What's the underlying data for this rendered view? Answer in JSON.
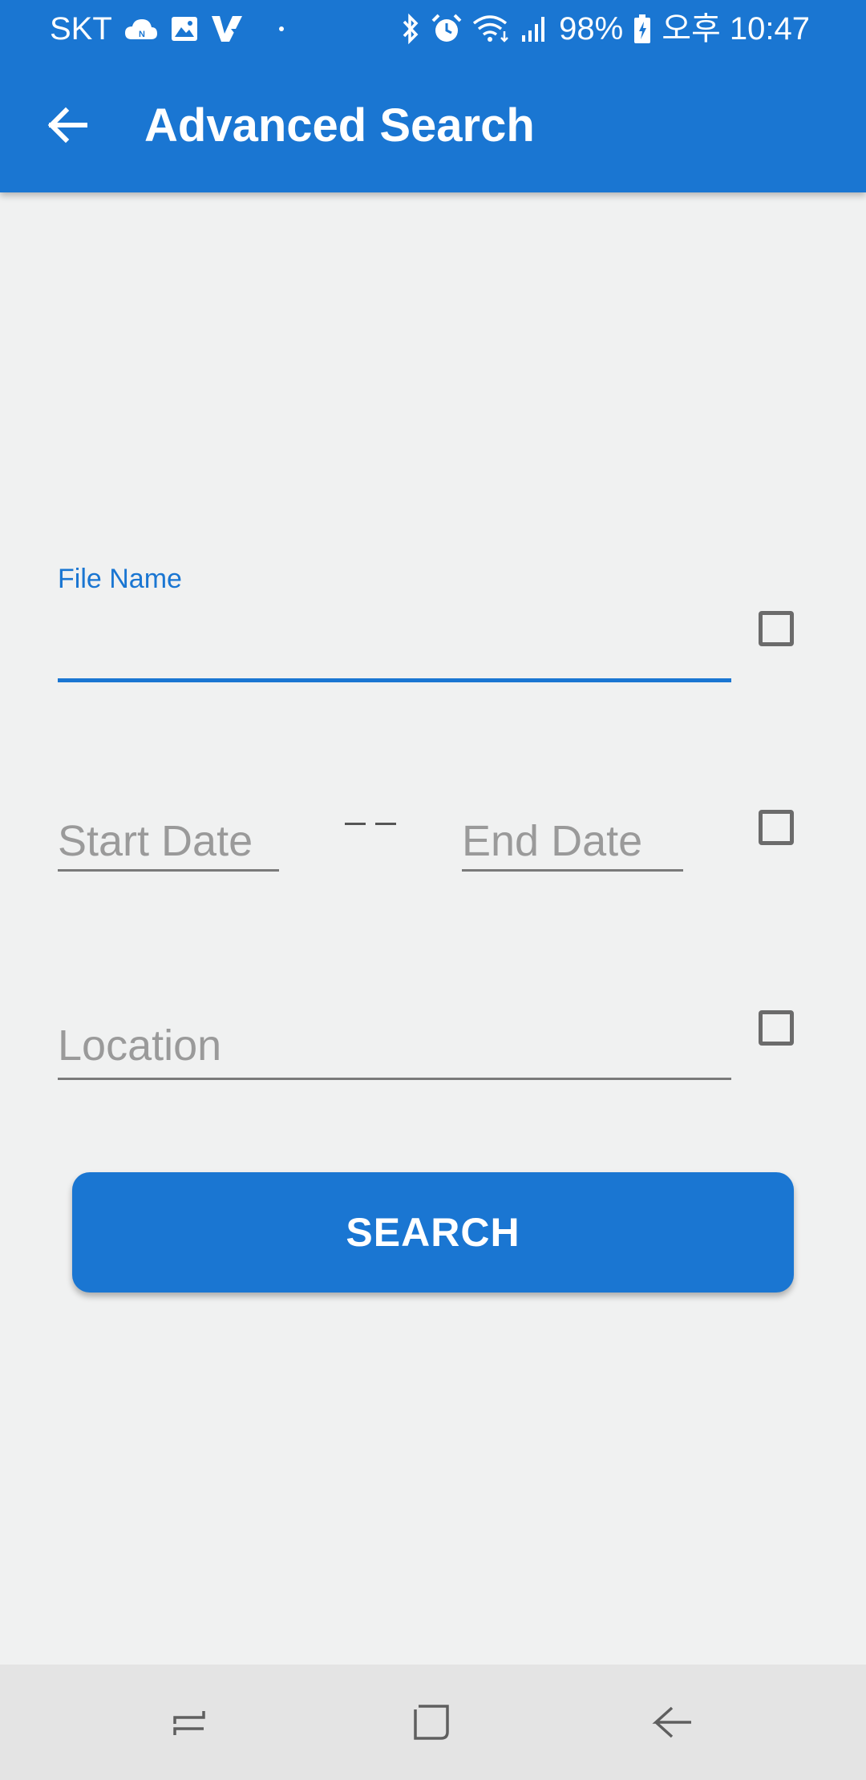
{
  "status_bar": {
    "carrier": "SKT",
    "battery": "98%",
    "time": "오후 10:47",
    "left_icons": [
      "cloud-icon",
      "image-icon",
      "v-app-icon"
    ],
    "right_icons": [
      "bluetooth-icon",
      "alarm-icon",
      "wifi-icon",
      "signal-icon",
      "battery-icon"
    ]
  },
  "toolbar": {
    "title": "Advanced Search",
    "back_icon": "back-arrow-icon"
  },
  "form": {
    "file_name": {
      "label": "File Name",
      "value": "",
      "checked": false
    },
    "date_range": {
      "start_placeholder": "Start Date",
      "end_placeholder": "End Date",
      "checked": false
    },
    "location": {
      "placeholder": "Location",
      "value": "",
      "checked": false
    },
    "search_label": "SEARCH"
  },
  "nav_bar": {
    "buttons": [
      "recents-icon",
      "home-icon",
      "back-icon"
    ]
  },
  "colors": {
    "primary": "#1a76d2",
    "background": "#f0f1f1",
    "navbar": "#e4e4e4",
    "placeholder": "#9a9a9a"
  }
}
